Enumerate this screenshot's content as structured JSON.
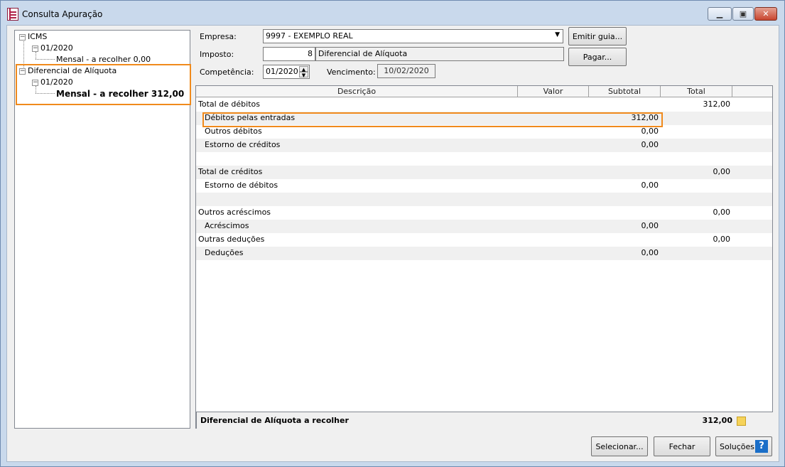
{
  "window": {
    "title": "Consulta Apuração"
  },
  "tree": {
    "root1": "ICMS",
    "root1_period": "01/2020",
    "root1_leaf": "Mensal - a recolher 0,00",
    "root2": "Diferencial de Alíquota",
    "root2_period": "01/2020",
    "root2_leaf": "Mensal - a recolher 312,00"
  },
  "form": {
    "empresa_label": "Empresa:",
    "empresa_value": "9997 - EXEMPLO REAL",
    "imposto_label": "Imposto:",
    "imposto_code": "8",
    "imposto_name": "Diferencial de Alíquota",
    "competencia_label": "Competência:",
    "competencia_value": "01/2020",
    "vencimento_label": "Vencimento:",
    "vencimento_value": "10/02/2020",
    "emitir_guia": "Emitir guia...",
    "pagar": "Pagar..."
  },
  "grid": {
    "headers": [
      "Descrição",
      "Valor",
      "Subtotal",
      "Total"
    ],
    "rows": [
      {
        "desc": "Total de débitos",
        "valor": "",
        "subtotal": "",
        "total": "312,00"
      },
      {
        "desc": "Débitos pelas entradas",
        "valor": "",
        "subtotal": "312,00",
        "total": ""
      },
      {
        "desc": "Outros débitos",
        "valor": "",
        "subtotal": "0,00",
        "total": ""
      },
      {
        "desc": "Estorno de créditos",
        "valor": "",
        "subtotal": "0,00",
        "total": ""
      },
      {
        "desc": "",
        "valor": "",
        "subtotal": "",
        "total": ""
      },
      {
        "desc": "Total de créditos",
        "valor": "",
        "subtotal": "",
        "total": "0,00"
      },
      {
        "desc": "Estorno de débitos",
        "valor": "",
        "subtotal": "0,00",
        "total": ""
      },
      {
        "desc": "",
        "valor": "",
        "subtotal": "",
        "total": ""
      },
      {
        "desc": "Outros acréscimos",
        "valor": "",
        "subtotal": "",
        "total": "0,00"
      },
      {
        "desc": "Acréscimos",
        "valor": "",
        "subtotal": "0,00",
        "total": ""
      },
      {
        "desc": "Outras deduções",
        "valor": "",
        "subtotal": "",
        "total": "0,00"
      },
      {
        "desc": "Deduções",
        "valor": "",
        "subtotal": "0,00",
        "total": ""
      }
    ],
    "footer_label": "Diferencial de Alíquota a recolher",
    "footer_total": "312,00"
  },
  "buttons": {
    "selecionar": "Selecionar...",
    "fechar": "Fechar",
    "solucoes": "Soluções"
  },
  "colors": {
    "highlight": "#f08a1c",
    "accent": "#1a6ec8"
  }
}
